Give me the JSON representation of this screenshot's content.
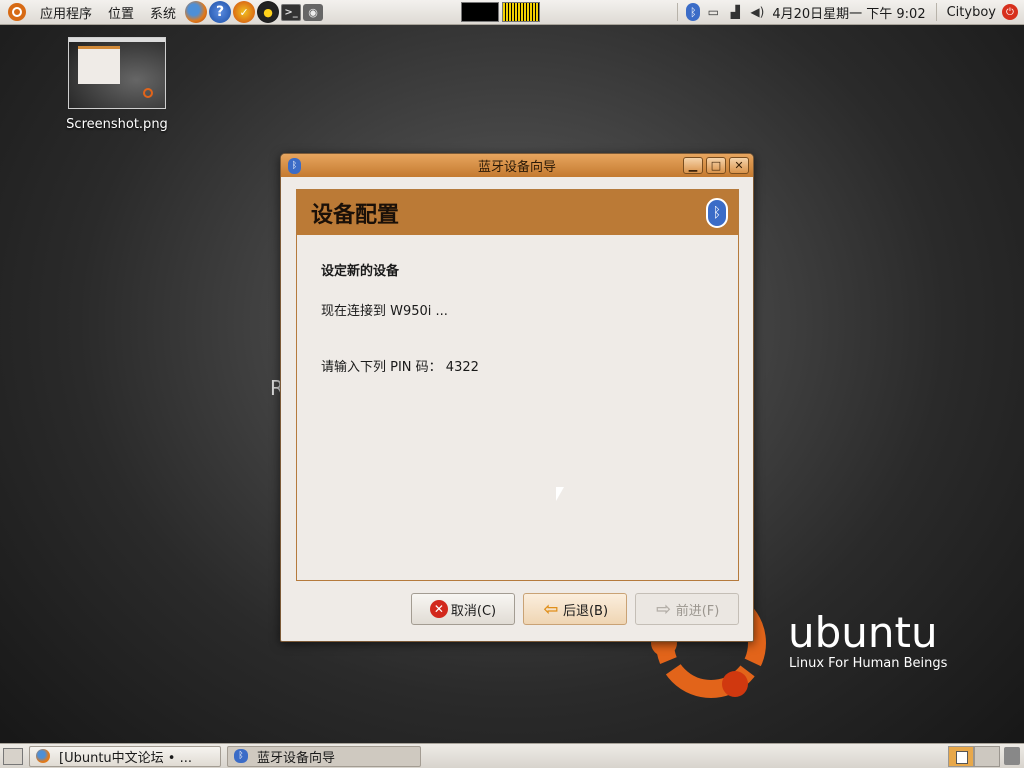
{
  "top_panel": {
    "menus": [
      "应用程序",
      "位置",
      "系统"
    ],
    "clock": "4月20日星期一 下午 9:02",
    "user": "Cityboy"
  },
  "desktop": {
    "icons": [
      {
        "label": "Screenshot.png"
      }
    ],
    "ghost_text": "R",
    "wallpaper_word": "ubuntu",
    "wallpaper_tagline": "Linux For Human Beings"
  },
  "dialog": {
    "title": "蓝牙设备向导",
    "header": "设备配置",
    "section_title": "设定新的设备",
    "status": "现在连接到 W950i ...",
    "pin_line": "请输入下列 PIN 码： 4322",
    "buttons": {
      "cancel": "取消(C)",
      "back": "后退(B)",
      "next": "前进(F)"
    }
  },
  "taskbar": {
    "tasks": [
      {
        "label": "[Ubuntu中文论坛 • ...",
        "active": false
      },
      {
        "label": "蓝牙设备向导",
        "active": true
      }
    ]
  },
  "colors": {
    "title_gradient_top": "#e7a55e",
    "header_orange": "#bb7a36",
    "dialog_bg": "#efebe7",
    "ubuntu_orange": "#e2641a"
  }
}
